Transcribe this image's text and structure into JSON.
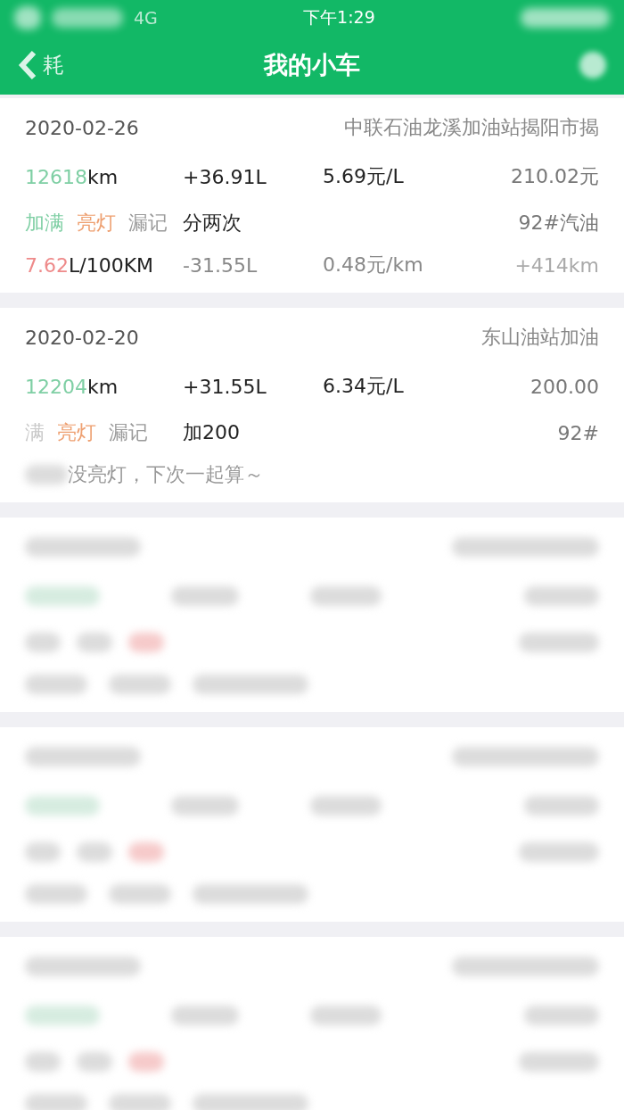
{
  "status_bar": {
    "network": "4G",
    "time": "下午1:29"
  },
  "nav": {
    "back_label": "耗",
    "title": "我的小车"
  },
  "records": [
    {
      "kind": "detail",
      "date": "2020-02-26",
      "station": "中联石油龙溪加油站揭阳市揭",
      "odometer": "12618",
      "odometer_unit": "km",
      "added": "+36.91L",
      "price": "5.69元/L",
      "cost": "210.02元",
      "tags": [
        {
          "label": "加满",
          "color": "#7fcfa4"
        },
        {
          "label": "亮灯",
          "color": "#eea071"
        },
        {
          "label": "漏记",
          "color": "#9b9b9b"
        }
      ],
      "remark": "分两次",
      "fuel": "92#汽油",
      "economy": "7.62",
      "economy_unit": "L/100KM",
      "used": "-31.55L",
      "per_km": "0.48元/km",
      "distance": "+414km"
    },
    {
      "kind": "note",
      "date": "2020-02-20",
      "station": "东山油站加油",
      "odometer": "12204",
      "odometer_unit": "km",
      "added": "+31.55L",
      "price": "6.34元/L",
      "cost": "200.00",
      "tags": [
        {
          "label": "满",
          "color": "#c8c8c8"
        },
        {
          "label": "亮灯",
          "color": "#eea071"
        },
        {
          "label": "漏记",
          "color": "#9b9b9b"
        }
      ],
      "remark": "加200",
      "fuel": "92#",
      "note": "没亮灯，下次一起算～"
    },
    {
      "kind": "blurred"
    },
    {
      "kind": "blurred"
    },
    {
      "kind": "blurred"
    }
  ]
}
